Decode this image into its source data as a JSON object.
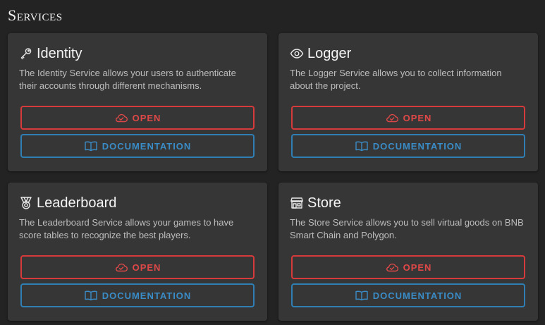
{
  "page": {
    "title": "Services"
  },
  "colors": {
    "open": "#e04848",
    "documentation": "#3a8cc7",
    "card_bg": "#363636",
    "page_bg": "#232323"
  },
  "services": [
    {
      "icon": "key-icon",
      "title": "Identity",
      "description": "The Identity Service allows your users to authenticate their accounts through different mechanisms.",
      "open_label": "OPEN",
      "doc_label": "DOCUMENTATION"
    },
    {
      "icon": "eye-icon",
      "title": "Logger",
      "description": "The Logger Service allows you to collect information about the project.",
      "open_label": "OPEN",
      "doc_label": "DOCUMENTATION"
    },
    {
      "icon": "medal-icon",
      "title": "Leaderboard",
      "description": "The Leaderboard Service allows your games to have score tables to recognize the best players.",
      "open_label": "OPEN",
      "doc_label": "DOCUMENTATION"
    },
    {
      "icon": "store-icon",
      "title": "Store",
      "description": "The Store Service allows you to sell virtual goods on BNB Smart Chain and Polygon.",
      "open_label": "OPEN",
      "doc_label": "DOCUMENTATION"
    }
  ]
}
